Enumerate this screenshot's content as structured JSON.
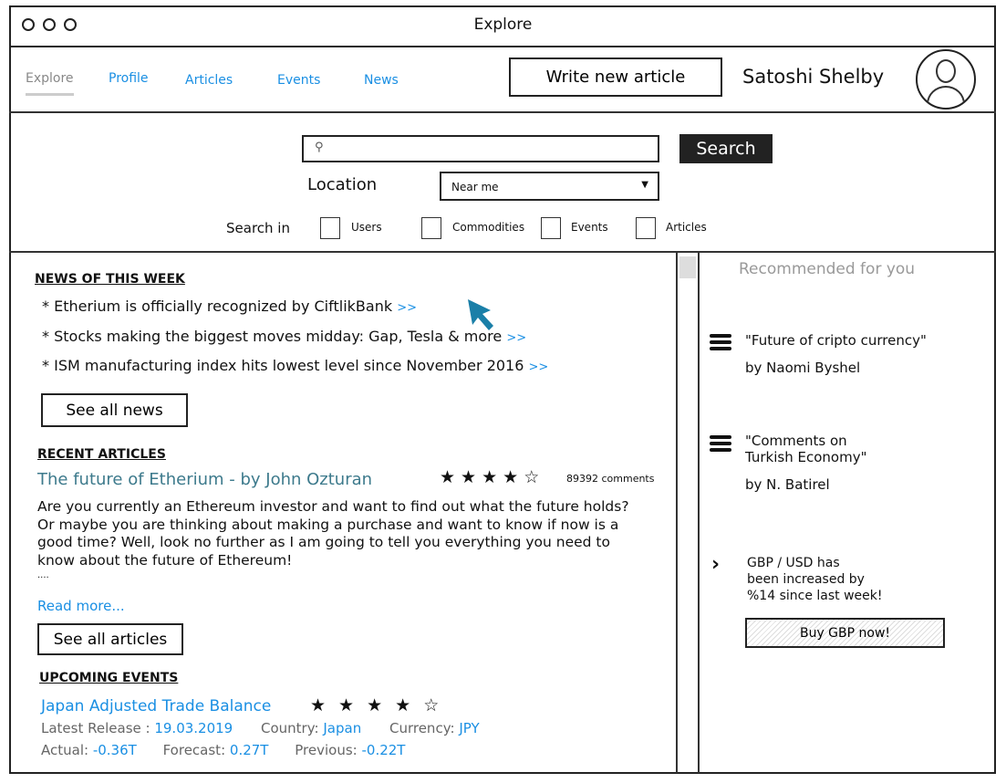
{
  "window": {
    "title": "Explore"
  },
  "nav": {
    "items": [
      {
        "label": "Explore",
        "active": true
      },
      {
        "label": "Profile"
      },
      {
        "label": "Articles"
      },
      {
        "label": "Events"
      },
      {
        "label": "News"
      }
    ],
    "write_button": "Write new article",
    "user_name": "Satoshi Shelby",
    "avatar_icon": "user-avatar-icon"
  },
  "search": {
    "placeholder": "",
    "value": "",
    "button": "Search",
    "location_label": "Location",
    "location_value": "Near me",
    "search_in_label": "Search in",
    "options": [
      {
        "label": "Users",
        "checked": false
      },
      {
        "label": "Commodities",
        "checked": false
      },
      {
        "label": "Events",
        "checked": false
      },
      {
        "label": "Articles",
        "checked": false
      }
    ]
  },
  "news": {
    "heading": "NEWS OF THIS WEEK",
    "items": [
      {
        "text": "Etherium is officially recognized by CiftlikBank",
        "more": ">>"
      },
      {
        "text": "Stocks making the biggest moves midday: Gap, Tesla & more",
        "more": ">>"
      },
      {
        "text": "ISM manufacturing index hits lowest level since November 2016",
        "more": ">>"
      }
    ],
    "see_all": "See all news"
  },
  "articles": {
    "heading": "RECENT ARTICLES",
    "title": "The future of Etherium - by John Ozturan",
    "rating": 4,
    "rating_max": 5,
    "comments": "89392 comments",
    "body": "Are you currently an Ethereum investor and want to find out what the future holds? Or maybe you are thinking about making a purchase and want to know if now is a good time? Well, look no further as I am going to tell you everything you need to know about the future of Ethereum!",
    "ellipsis": "....",
    "read_more": "Read more...",
    "see_all": "See all articles"
  },
  "events": {
    "heading": "UPCOMING EVENTS",
    "title": "Japan Adjusted Trade Balance",
    "rating": 4,
    "rating_max": 5,
    "latest_release_label": "Latest Release :",
    "latest_release": "19.03.2019",
    "country_label": "Country:",
    "country": "Japan",
    "currency_label": "Currency:",
    "currency": "JPY",
    "actual_label": "Actual:",
    "actual": "-0.36T",
    "forecast_label": "Forecast:",
    "forecast": "0.27T",
    "previous_label": "Previous:",
    "previous": "-0.22T"
  },
  "sidebar": {
    "heading": "Recommended for you",
    "items": [
      {
        "title": "\"Future of cripto currency\"",
        "author": "by Naomi Byshel"
      },
      {
        "title1": "\"Comments on",
        "title2": "Turkish Economy\"",
        "author": "by N. Batirel"
      }
    ],
    "promo": {
      "line1": "GBP / USD has",
      "line2": "been increased by",
      "line3": "%14 since last week!",
      "button": "Buy GBP now!"
    }
  },
  "colors": {
    "link": "#1a8fe3",
    "article_title": "#3d7a8c",
    "cursor": "#1a7fa8"
  }
}
